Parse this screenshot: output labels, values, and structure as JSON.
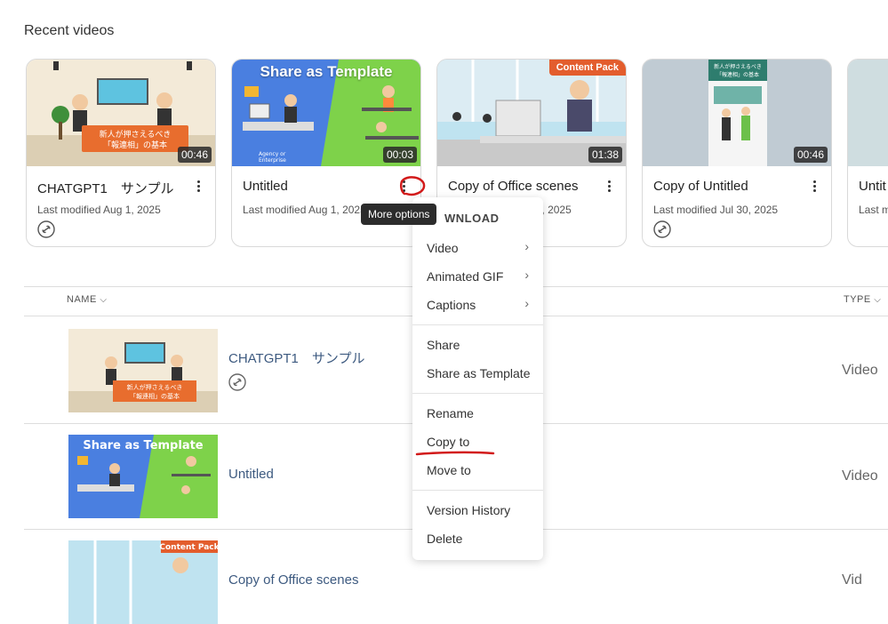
{
  "section": {
    "title": "Recent videos"
  },
  "cards": [
    {
      "title": "CHATGPT1　サンプル",
      "meta": "Last modified Aug 1, 2025",
      "duration": "00:46",
      "thumb_text": "新人が押さえるべき 「報連相」の基本"
    },
    {
      "title": "Untitled",
      "meta": "Last modified Aug 1, 2025",
      "duration": "00:03",
      "thumb_title": "Share as Template",
      "thumb_caption": "Agency or Enterprise"
    },
    {
      "title": "Copy of Office scenes",
      "meta": "Last modified Aug 1, 2025",
      "duration": "01:38",
      "badge": "Content Pack"
    },
    {
      "title": "Copy of Untitled",
      "meta": "Last modified Jul 30, 2025",
      "duration": "00:46",
      "thumb_text": "新人が押さえるべき 「報連相」の基本"
    },
    {
      "title": "Untit",
      "meta": "Last m"
    }
  ],
  "tooltip": "More options",
  "menu": {
    "header": "WNLOAD",
    "group1": [
      "Video",
      "Animated GIF",
      "Captions"
    ],
    "group2": [
      "Share",
      "Share as Template"
    ],
    "group3": [
      "Rename",
      "Copy to",
      "Move to"
    ],
    "group4": [
      "Version History",
      "Delete"
    ]
  },
  "table": {
    "col_name": "NAME",
    "col_type": "TYPE",
    "rows": [
      {
        "name": "CHATGPT1　サンプル",
        "type": "Video"
      },
      {
        "name": "Untitled",
        "type": "Video"
      },
      {
        "name": "Copy of Office scenes",
        "type": "Vid"
      }
    ]
  },
  "colors": {
    "annotation": "#d21a1a",
    "badge": "#e35d2d",
    "link": "#3d5a80"
  }
}
